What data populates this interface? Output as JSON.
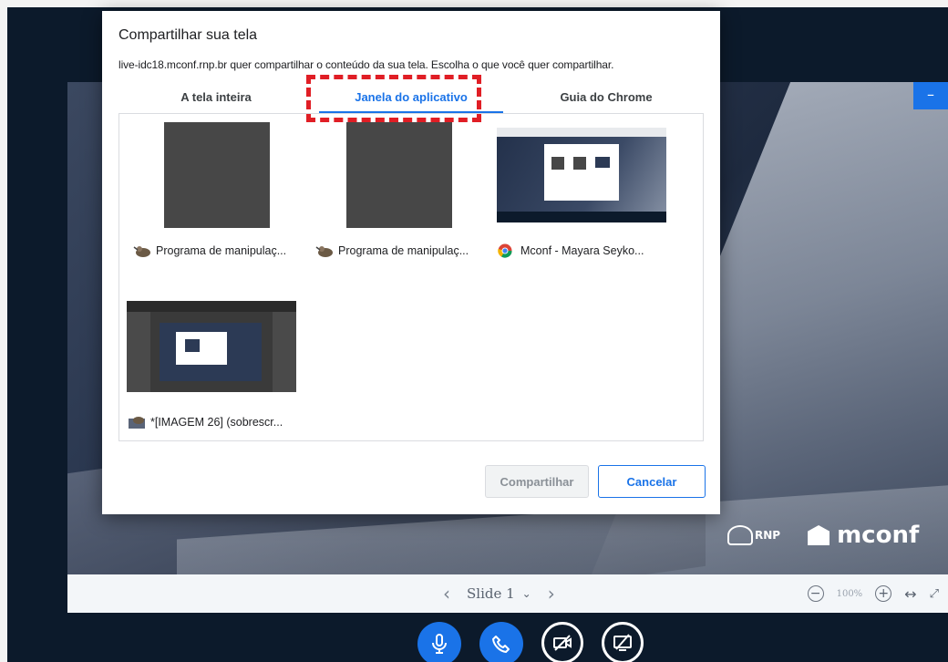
{
  "dialog": {
    "title": "Compartilhar sua tela",
    "subtitle": "live-idc18.mconf.rnp.br quer compartilhar o conteúdo da sua tela. Escolha o que você quer compartilhar.",
    "tabs": [
      {
        "label": "A tela inteira",
        "active": false
      },
      {
        "label": "Janela do aplicativo",
        "active": true
      },
      {
        "label": "Guia do Chrome",
        "active": false
      }
    ],
    "windows": [
      {
        "label": "Programa de manipulaç...",
        "icon": "gimp-icon"
      },
      {
        "label": "Programa de manipulaç...",
        "icon": "gimp-icon"
      },
      {
        "label": "Mconf - Mayara Seyko...",
        "icon": "chrome-icon"
      },
      {
        "label": "*[IMAGEM 26] (sobrescr...",
        "icon": "gimp-icon"
      }
    ],
    "share_label": "Compartilhar",
    "cancel_label": "Cancelar"
  },
  "presentation": {
    "slide_label": "Slide 1",
    "zoom": "100%",
    "logos": {
      "rnp": "RNP",
      "mconf": "mconf"
    }
  },
  "colors": {
    "accent": "#1a73e8",
    "highlight": "#e01e25"
  }
}
